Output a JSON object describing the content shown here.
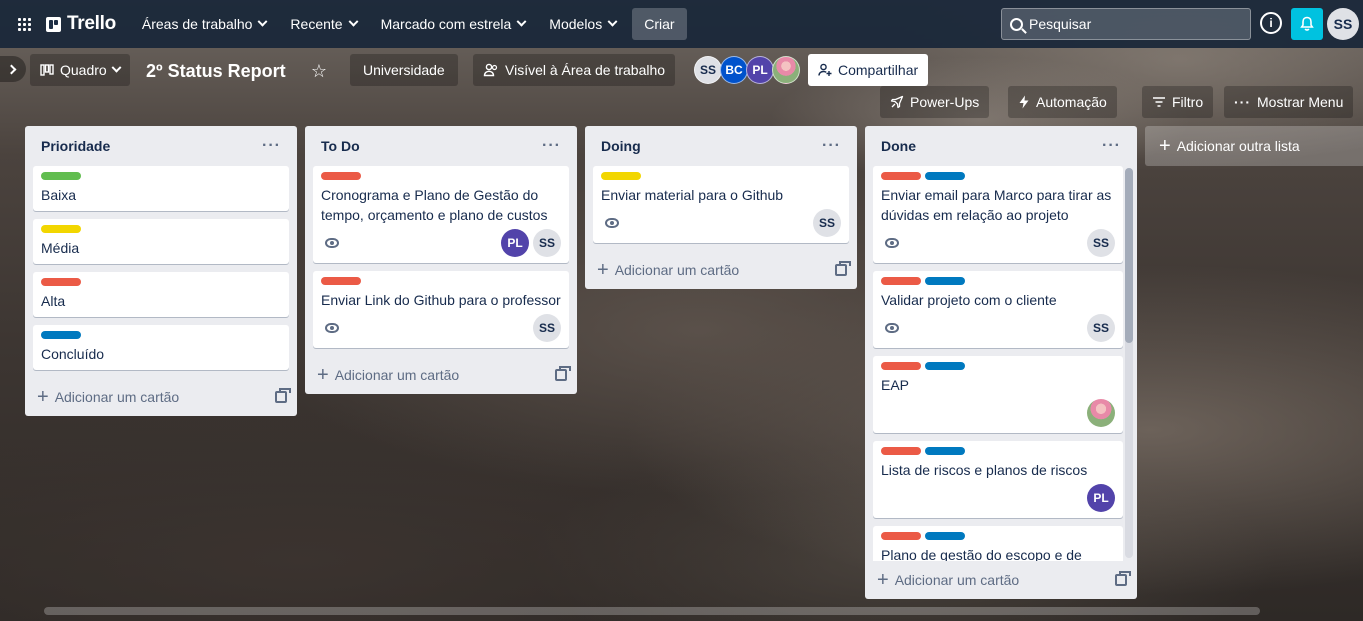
{
  "topnav": {
    "logo": "Trello",
    "menus": [
      {
        "label": "Áreas de trabalho"
      },
      {
        "label": "Recente"
      },
      {
        "label": "Marcado com estrela"
      },
      {
        "label": "Modelos"
      }
    ],
    "create_label": "Criar",
    "search_placeholder": "Pesquisar",
    "info_glyph": "i",
    "user_initials": "SS"
  },
  "board": {
    "view_label": "Quadro",
    "title": "2º Status Report",
    "workspace_label": "Universidade",
    "visibility_label": "Visível à Área de trabalho",
    "members": [
      "SS",
      "BC",
      "PL"
    ],
    "share_label": "Compartilhar",
    "powerups_label": "Power-Ups",
    "automation_label": "Automação",
    "filter_label": "Filtro",
    "menu_label": "Mostrar Menu",
    "add_list_label": "Adicionar outra lista"
  },
  "colors": {
    "green": "#61bd4f",
    "yellow": "#f2d600",
    "red": "#eb5a46",
    "blue": "#0079bf"
  },
  "lists": [
    {
      "title": "Prioridade",
      "menu": "···",
      "add_card": "Adicionar um cartão",
      "cards": [
        {
          "title": "Baixa"
        },
        {
          "title": "Média"
        },
        {
          "title": "Alta"
        },
        {
          "title": "Concluído"
        }
      ]
    },
    {
      "title": "To Do",
      "menu": "···",
      "add_card": "Adicionar um cartão",
      "cards": [
        {
          "title": "Cronograma e Plano de Gestão do tempo, orçamento e plano de custos",
          "members": [
            "PL",
            "SS"
          ]
        },
        {
          "title": "Enviar Link do Github para o professor",
          "members": [
            "SS"
          ]
        }
      ]
    },
    {
      "title": "Doing",
      "menu": "···",
      "add_card": "Adicionar um cartão",
      "cards": [
        {
          "title": "Enviar material para o Github",
          "members": [
            "SS"
          ]
        }
      ]
    },
    {
      "title": "Done",
      "menu": "···",
      "add_card": "Adicionar um cartão",
      "cards": [
        {
          "title": "Enviar email para Marco para tirar as dúvidas em relação ao projeto",
          "members": [
            "SS"
          ]
        },
        {
          "title": "Validar projeto com o cliente",
          "members": [
            "SS"
          ]
        },
        {
          "title": "EAP"
        },
        {
          "title": "Lista de riscos e planos de riscos",
          "members": [
            "PL"
          ]
        },
        {
          "title": "Plano de gestão do escopo e de"
        }
      ]
    }
  ]
}
